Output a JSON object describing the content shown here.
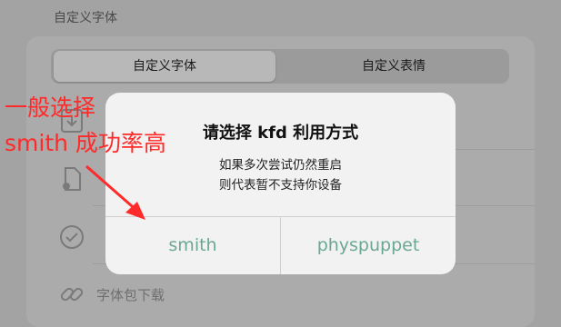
{
  "section_header": "自定义字体",
  "segmented": {
    "tab1": "自定义字体",
    "tab2": "自定义表情"
  },
  "list": {
    "font_pack_download": "字体包下载"
  },
  "alert": {
    "title": "请选择 kfd 利用方式",
    "message_line1": "如果多次尝试仍然重启",
    "message_line2": "则代表暂不支持你设备",
    "button_left": "smith",
    "button_right": "physpuppet"
  },
  "annotation": {
    "line1": "一般选择",
    "line2": "smith 成功率高",
    "color": "#ff2a2a"
  },
  "colors": {
    "button_text": "#6aa895",
    "dim_background": "#a3a3a3"
  }
}
